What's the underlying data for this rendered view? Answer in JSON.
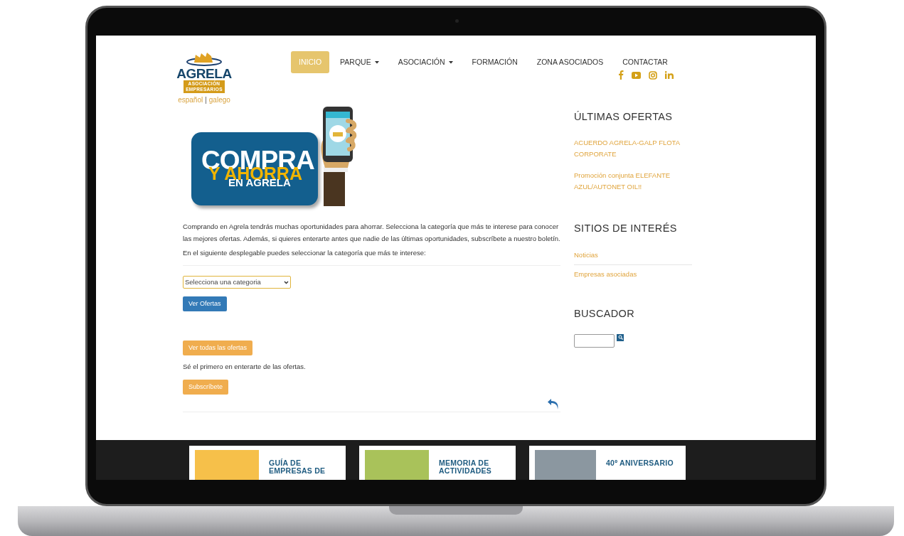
{
  "logo": {
    "title": "AGRELA",
    "subtitle_1": "ASOCIACIÓN",
    "subtitle_2": "EMPRESARIOS"
  },
  "languages": {
    "items": [
      "español",
      "galego"
    ],
    "separator": "|"
  },
  "nav": [
    {
      "label": "INICIO",
      "selected": true,
      "dropdown": false
    },
    {
      "label": "PARQUE",
      "selected": false,
      "dropdown": true
    },
    {
      "label": "ASOCIACIÓN",
      "selected": false,
      "dropdown": true
    },
    {
      "label": "FORMACIÓN",
      "selected": false,
      "dropdown": false
    },
    {
      "label": "ZONA ASOCIADOS",
      "selected": false,
      "dropdown": false
    },
    {
      "label": "CONTACTAR",
      "selected": false,
      "dropdown": false
    }
  ],
  "social": [
    {
      "kind": "facebook"
    },
    {
      "kind": "youtube"
    },
    {
      "kind": "instagram"
    },
    {
      "kind": "linkedin"
    }
  ],
  "banner": {
    "line_1": "COMPRA",
    "line_2": "Y AHORRA",
    "line_3": "EN AGRELA"
  },
  "intro": "Comprando en Agrela tendrás muchas oportunidades para ahorrar. Selecciona la categoría que más te interese para conocer las mejores ofertas. Además, si quieres enterarte antes que nadie de las últimas oportunidades, subscríbete a nuestro boletín.",
  "select_hint": "En el siguiente desplegable puedes seleccionar la categoría que más te interese:",
  "category_select": {
    "value": "Selecciona una categoria"
  },
  "view_offers_button": "Ver Ofertas",
  "all_offers_button": "Ver todas las ofertas",
  "subscribe_text": "Sé el primero en enterarte de las ofertas.",
  "subscribe_button": "Subscríbete",
  "sidebar": {
    "offers_title": "ÚLTIMAS OFERTAS",
    "offers": [
      "ACUERDO AGRELA-GALP FLOTA CORPORATE",
      "Promoción conjunta ELEFANTE AZUL/AUTONET OIL!!"
    ],
    "sites_title": "SITIOS DE INTERÉS",
    "sites": [
      "Noticias",
      "Empresas asociadas"
    ],
    "search_title": "BUSCADOR"
  },
  "footer_cards": [
    {
      "title": "GUÍA DE EMPRESAS DE"
    },
    {
      "title": "MEMORIA DE ACTIVIDADES"
    },
    {
      "title": "40º ANIVERSARIO"
    }
  ]
}
